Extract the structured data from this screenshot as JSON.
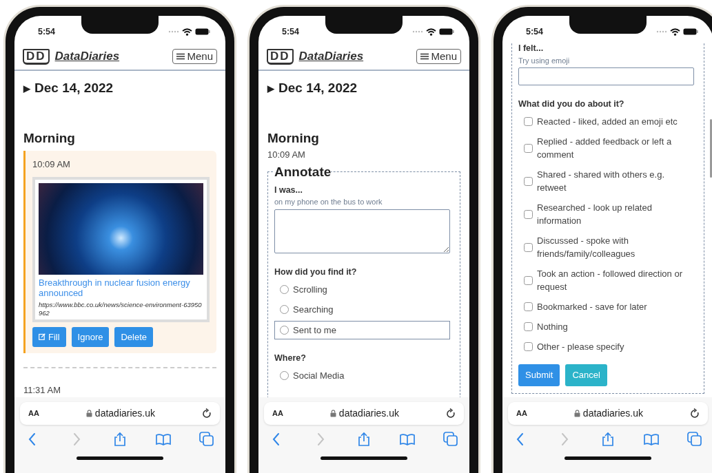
{
  "phones": [
    {
      "status_time": "5:54",
      "header": {
        "logo": "DD",
        "brand": "DataDiaries",
        "menu": "Menu"
      },
      "blocks": [
        {
          "kind": "date",
          "arrow": "▶",
          "text": "Dec 14, 2022"
        },
        {
          "kind": "heading",
          "text": "Morning"
        },
        {
          "kind": "entry",
          "time": "10:09 AM",
          "link": "Breakthrough in nuclear fusion energy announced",
          "url": "https://www.bbc.co.uk/news/science-environment-63950962",
          "buttons": [
            {
              "kind": "edit",
              "label": "Fill"
            },
            {
              "kind": "plain",
              "label": "Ignore"
            },
            {
              "kind": "plain",
              "label": "Delete"
            }
          ]
        },
        {
          "kind": "divider"
        },
        {
          "kind": "time",
          "text": "11:31 AM"
        }
      ],
      "address": {
        "text_size": "AA",
        "url": "datadiaries.uk"
      },
      "toolbar": [
        {
          "kind": "back",
          "disabled": false
        },
        {
          "kind": "forward",
          "disabled": true
        },
        {
          "kind": "share",
          "disabled": false
        },
        {
          "kind": "bookmarks",
          "disabled": false
        },
        {
          "kind": "tabs",
          "disabled": false
        }
      ]
    },
    {
      "status_time": "5:54",
      "header": {
        "logo": "DD",
        "brand": "DataDiaries",
        "menu": "Menu"
      },
      "blocks": [
        {
          "kind": "date",
          "arrow": "▶",
          "text": "Dec 14, 2022"
        },
        {
          "kind": "heading",
          "text": "Morning"
        },
        {
          "kind": "time",
          "text": "10:09 AM"
        },
        {
          "kind": "fieldset",
          "legend": "Annotate",
          "continued_above": false,
          "continues_below": true,
          "items": [
            {
              "kind": "textarea",
              "label": "I was...",
              "hint": "on my phone on the bus to work"
            },
            {
              "kind": "radios",
              "label": "How did you find it?",
              "options": [
                {
                  "text": "Scrolling",
                  "checked": false,
                  "highlighted": false
                },
                {
                  "text": "Searching",
                  "checked": false,
                  "highlighted": false
                },
                {
                  "text": "Sent to me",
                  "checked": false,
                  "highlighted": true
                }
              ]
            },
            {
              "kind": "radios",
              "label": "Where?",
              "options": [
                {
                  "text": "Social Media",
                  "checked": false,
                  "highlighted": false
                }
              ]
            }
          ]
        }
      ],
      "address": {
        "text_size": "AA",
        "url": "datadiaries.uk"
      },
      "toolbar": [
        {
          "kind": "back",
          "disabled": false
        },
        {
          "kind": "forward",
          "disabled": true
        },
        {
          "kind": "share",
          "disabled": false
        },
        {
          "kind": "bookmarks",
          "disabled": false
        },
        {
          "kind": "tabs",
          "disabled": false
        }
      ]
    },
    {
      "status_time": "5:54",
      "scrollbar_visible": true,
      "blocks": [
        {
          "kind": "fieldset",
          "continued_above": true,
          "continues_below": false,
          "items": [
            {
              "kind": "text_input",
              "label": "I felt...",
              "hint": "Try using emoji"
            },
            {
              "kind": "checkboxes",
              "label": "What did you do about it?",
              "options": [
                {
                  "text": "Reacted - liked, added an emoji etc",
                  "checked": false
                },
                {
                  "text": "Replied - added feedback or left a comment",
                  "checked": false
                },
                {
                  "text": "Shared - shared with others e.g. retweet",
                  "checked": false
                },
                {
                  "text": "Researched - look up related information",
                  "checked": false
                },
                {
                  "text": "Discussed - spoke with friends/family/colleagues",
                  "checked": false
                },
                {
                  "text": "Took an action - followed direction or request",
                  "checked": false
                },
                {
                  "text": "Bookmarked - save for later",
                  "checked": false
                },
                {
                  "text": "Nothing",
                  "checked": false
                },
                {
                  "text": "Other - please specify",
                  "checked": false
                }
              ]
            },
            {
              "kind": "buttons",
              "buttons": [
                {
                  "kind": "primary",
                  "label": "Submit"
                },
                {
                  "kind": "secondary",
                  "label": "Cancel"
                }
              ]
            }
          ]
        }
      ],
      "address": {
        "text_size": "AA",
        "url": "datadiaries.uk"
      },
      "toolbar": [
        {
          "kind": "back",
          "disabled": false
        },
        {
          "kind": "forward",
          "disabled": true
        },
        {
          "kind": "share",
          "disabled": false
        },
        {
          "kind": "bookmarks",
          "disabled": false
        },
        {
          "kind": "tabs",
          "disabled": false
        }
      ]
    }
  ]
}
